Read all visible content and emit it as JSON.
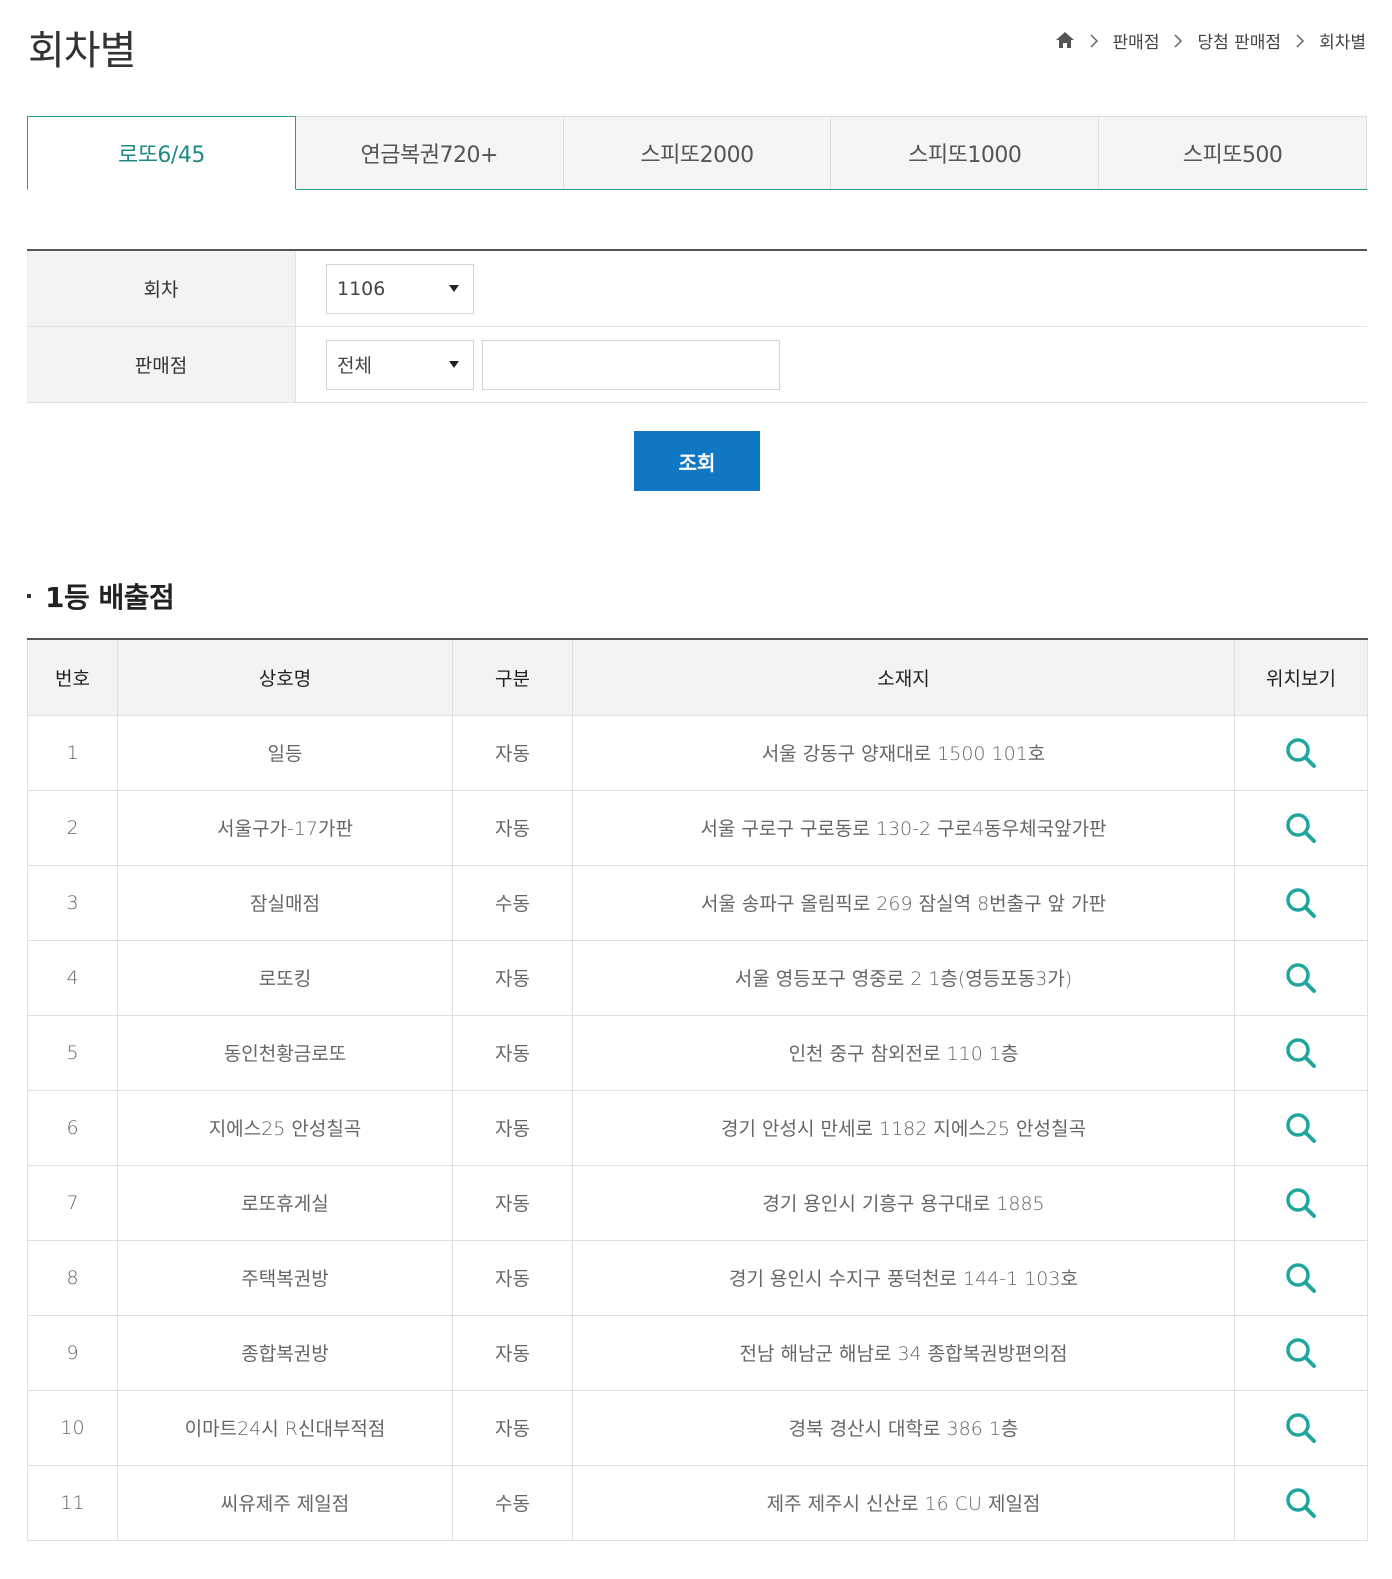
{
  "page": {
    "title": "회차별"
  },
  "breadcrumb": {
    "items": [
      "판매점",
      "당첨 판매점",
      "회차별"
    ]
  },
  "tabs": [
    {
      "label": "로또6/45",
      "active": true
    },
    {
      "label": "연금복권720+",
      "active": false
    },
    {
      "label": "스피또2000",
      "active": false
    },
    {
      "label": "스피또1000",
      "active": false
    },
    {
      "label": "스피또500",
      "active": false
    }
  ],
  "form": {
    "round_label": "회차",
    "round_value": "1106",
    "store_label": "판매점",
    "store_filter_value": "전체",
    "store_search_value": ""
  },
  "search_button": "조회",
  "section": {
    "title": "1등 배출점"
  },
  "table": {
    "headers": [
      "번호",
      "상호명",
      "구분",
      "소재지",
      "위치보기"
    ],
    "rows": [
      {
        "no": "1",
        "name": "일등",
        "type": "자동",
        "address": "서울 강동구 양재대로 1500 101호"
      },
      {
        "no": "2",
        "name": "서울구가-17가판",
        "type": "자동",
        "address": "서울 구로구 구로동로 130-2 구로4동우체국앞가판"
      },
      {
        "no": "3",
        "name": "잠실매점",
        "type": "수동",
        "address": "서울 송파구 올림픽로 269 잠실역 8번출구 앞 가판"
      },
      {
        "no": "4",
        "name": "로또킹",
        "type": "자동",
        "address": "서울 영등포구 영중로 2 1층(영등포동3가)"
      },
      {
        "no": "5",
        "name": "동인천황금로또",
        "type": "자동",
        "address": "인천 중구 참외전로 110 1층"
      },
      {
        "no": "6",
        "name": "지에스25 안성칠곡",
        "type": "자동",
        "address": "경기 안성시 만세로 1182 지에스25 안성칠곡"
      },
      {
        "no": "7",
        "name": "로또휴게실",
        "type": "자동",
        "address": "경기 용인시 기흥구 용구대로 1885"
      },
      {
        "no": "8",
        "name": "주택복권방",
        "type": "자동",
        "address": "경기 용인시 수지구 풍덕천로 144-1 103호"
      },
      {
        "no": "9",
        "name": "종합복권방",
        "type": "자동",
        "address": "전남 해남군 해남로 34 종합복권방편의점"
      },
      {
        "no": "10",
        "name": "이마트24시 R신대부적점",
        "type": "자동",
        "address": "경북 경산시 대학로 386 1층"
      },
      {
        "no": "11",
        "name": "씨유제주 제일점",
        "type": "수동",
        "address": "제주 제주시 신산로 16 CU 제일점"
      }
    ]
  },
  "colors": {
    "accent": "#2b9a95",
    "button": "#0f77c4",
    "map_icon": "#1fa79d"
  },
  "icons": {
    "home": "home-icon",
    "separator": "chevron-right-icon",
    "map": "search-icon"
  }
}
